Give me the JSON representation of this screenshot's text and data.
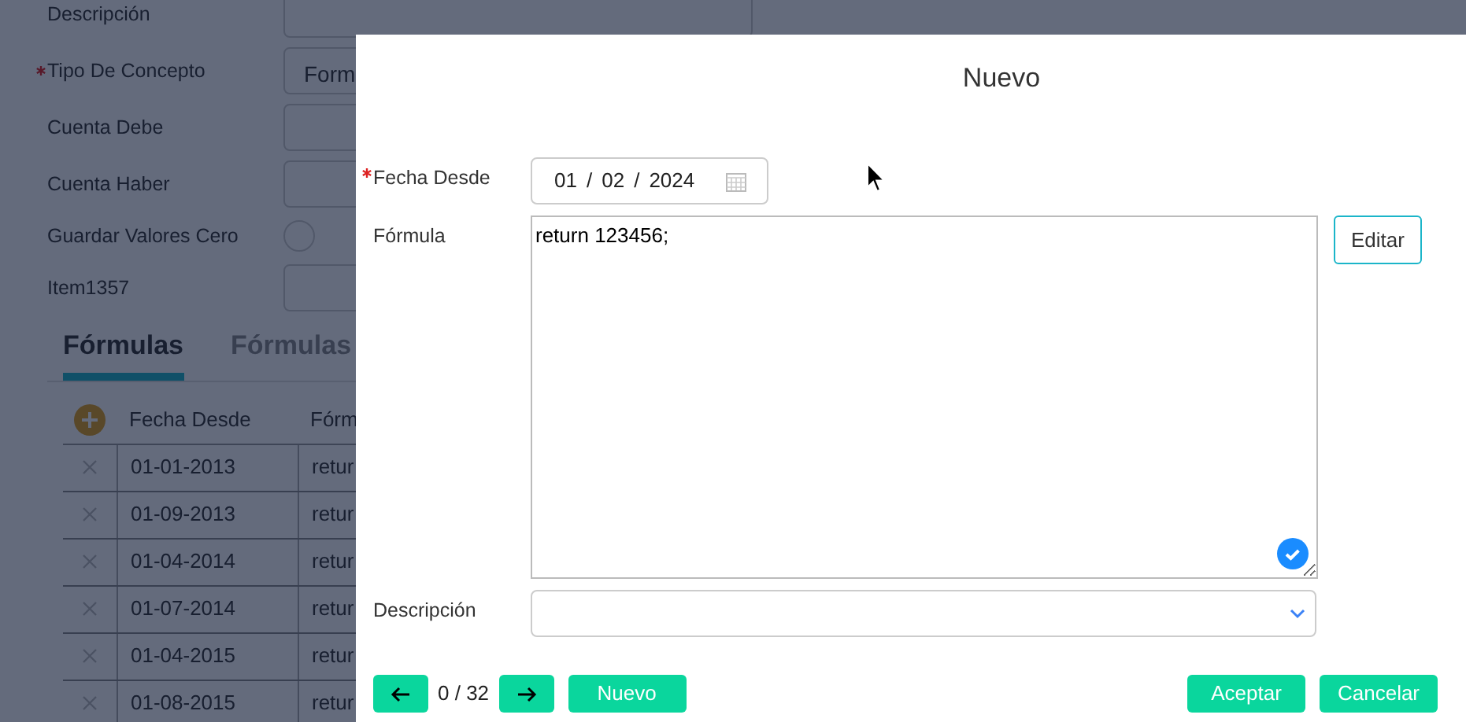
{
  "background_form": {
    "fields": [
      {
        "label": "Descripción",
        "required": false,
        "kind": "select"
      },
      {
        "label": "Tipo De Concepto",
        "required": true,
        "kind": "text",
        "value": "Form"
      },
      {
        "label": "Cuenta Debe",
        "required": false,
        "kind": "text"
      },
      {
        "label": "Cuenta Haber",
        "required": false,
        "kind": "text"
      },
      {
        "label": "Guardar Valores Cero",
        "required": false,
        "kind": "radio",
        "checked": false
      },
      {
        "label": "Item1357",
        "required": false,
        "kind": "text"
      }
    ],
    "tabs": [
      {
        "label": "Fórmulas",
        "selected": true
      },
      {
        "label": "Fórmulas",
        "selected": false
      }
    ],
    "table": {
      "columns": [
        "Fecha Desde",
        "Fórm"
      ],
      "rows": [
        {
          "fecha_desde": "01-01-2013",
          "formula": "retur"
        },
        {
          "fecha_desde": "01-09-2013",
          "formula": "retur"
        },
        {
          "fecha_desde": "01-04-2014",
          "formula": "retur"
        },
        {
          "fecha_desde": "01-07-2014",
          "formula": "retur"
        },
        {
          "fecha_desde": "01-04-2015",
          "formula": "retur"
        },
        {
          "fecha_desde": "01-08-2015",
          "formula": "retur"
        }
      ]
    }
  },
  "dialog": {
    "title": "Nuevo",
    "fecha_desde": {
      "label": "Fecha Desde",
      "required": true,
      "day": "01",
      "month": "02",
      "year": "2024",
      "separator": "/"
    },
    "formula": {
      "label": "Fórmula",
      "required": false,
      "value": "return 123456;",
      "edit_button": "Editar"
    },
    "descripcion": {
      "label": "Descripción",
      "required": false
    },
    "pager": "0 / 32",
    "buttons": {
      "new": "Nuevo",
      "accept": "Aceptar",
      "cancel": "Cancelar"
    }
  }
}
